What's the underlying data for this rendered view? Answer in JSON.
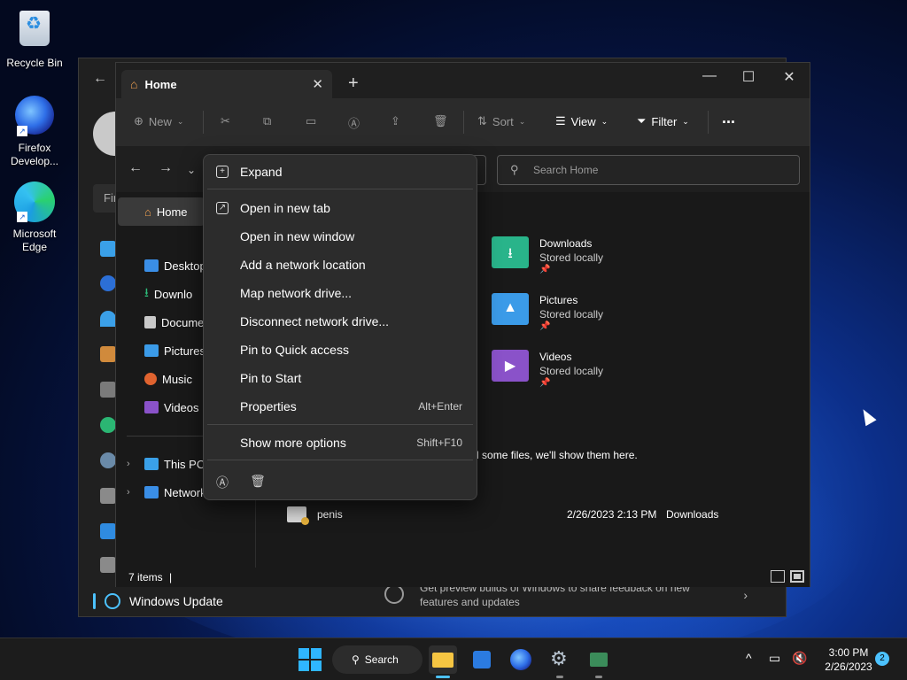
{
  "desktop": {
    "icons": [
      {
        "label": "Recycle Bin"
      },
      {
        "label": "Firefox Develop..."
      },
      {
        "label": "Microsoft Edge"
      }
    ]
  },
  "settings_window": {
    "find_placeholder": "Fir",
    "nav_selected": "Windows Update",
    "insider_text": "Get preview builds of Windows to share feedback on new features and updates"
  },
  "explorer": {
    "tab_title": "Home",
    "toolbar": {
      "new_label": "New",
      "sort_label": "Sort",
      "view_label": "View",
      "filter_label": "Filter",
      "more_label": "..."
    },
    "search_placeholder": "Search Home",
    "nav_pane": {
      "home_label": "Home",
      "pinned": [
        {
          "label": "Desktop",
          "color": "#3a8ee6"
        },
        {
          "label": "Downlo",
          "color": "#2dbd7a"
        },
        {
          "label": "Docume",
          "color": "#c9c9c9"
        },
        {
          "label": "Pictures",
          "color": "#3b9be8"
        },
        {
          "label": "Music",
          "color": "#e0632f"
        },
        {
          "label": "Videos",
          "color": "#8a52c9"
        }
      ],
      "this_pc": "This PC",
      "network": "Network"
    },
    "quick_access": [
      {
        "name": "Downloads",
        "status": "Stored locally",
        "color": "#29b48a",
        "glyph": "⭳"
      },
      {
        "name": "Pictures",
        "status": "Stored locally",
        "color": "#3b9be8",
        "glyph": "▲"
      },
      {
        "name": "Videos",
        "status": "Stored locally",
        "color": "#8a52c9",
        "glyph": "▶"
      }
    ],
    "recent_message": "nned some files, we'll show them here.",
    "files": [
      {
        "name": "penis",
        "date": "2/26/2023 2:13 PM",
        "location": "Downloads"
      }
    ],
    "status_count": "7 items",
    "status_sep": "|"
  },
  "context_menu": {
    "items": [
      {
        "label": "Expand",
        "shortcut": ""
      },
      {
        "label": "Open in new tab",
        "shortcut": ""
      },
      {
        "label": "Open in new window",
        "shortcut": ""
      },
      {
        "label": "Add a network location",
        "shortcut": ""
      },
      {
        "label": "Map network drive...",
        "shortcut": ""
      },
      {
        "label": "Disconnect network drive...",
        "shortcut": ""
      },
      {
        "label": "Pin to Quick access",
        "shortcut": ""
      },
      {
        "label": "Pin to Start",
        "shortcut": ""
      },
      {
        "label": "Properties",
        "shortcut": "Alt+Enter"
      },
      {
        "label": "Show more options",
        "shortcut": "Shift+F10"
      }
    ]
  },
  "taskbar": {
    "search_label": "Search",
    "time": "3:00 PM",
    "date": "2/26/2023",
    "notification_count": "2"
  }
}
